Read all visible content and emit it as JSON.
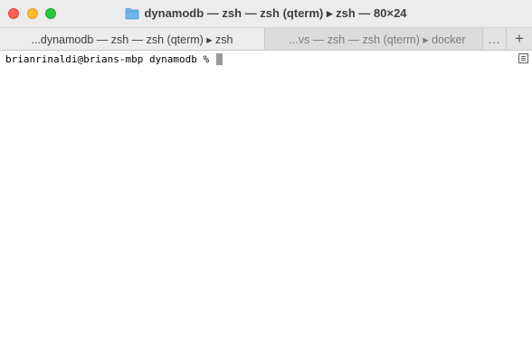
{
  "window": {
    "title": "dynamodb — zsh — zsh (qterm) ▸ zsh — 80×24",
    "icon": "folder-icon"
  },
  "tabs": [
    {
      "label": "...dynamodb — zsh — zsh (qterm) ▸ zsh",
      "active": true
    },
    {
      "label": "...vs — zsh — zsh (qterm) ▸ docker",
      "active": false
    }
  ],
  "tabbar": {
    "overflow_label": "...",
    "new_tab_label": "+"
  },
  "terminal": {
    "prompt": "brianrinaldi@brians-mbp dynamodb % "
  },
  "colors": {
    "close": "#ff5f57",
    "minimize": "#febc2e",
    "zoom": "#28c840",
    "folder": "#6fb7ea"
  }
}
